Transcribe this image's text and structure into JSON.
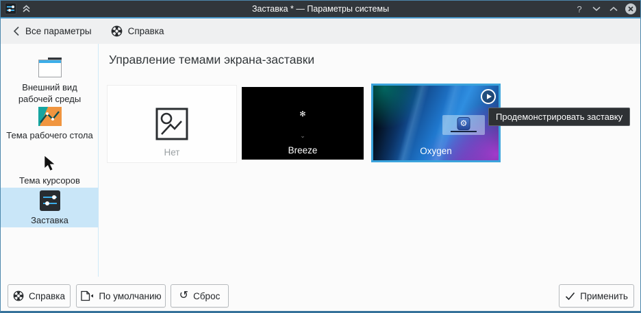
{
  "colors": {
    "accent": "#3daee9",
    "titlebar_bg": "#31363b",
    "selection_bg": "#c9e6f8",
    "window_bg": "#fbfbfb",
    "toolbar_bg": "#eff0f1",
    "selected_card_border": "#3ba3dc"
  },
  "titlebar": {
    "title": "Заставка * — Параметры системы",
    "controls": {
      "help": "?"
    }
  },
  "toolbar": {
    "back_label": "Все параметры",
    "help_label": "Справка"
  },
  "sidebar": {
    "items": [
      {
        "label": "Внешний вид рабочей среды",
        "icon": "desktop-appearance-icon",
        "selected": false
      },
      {
        "label": "Тема рабочего стола",
        "icon": "desktop-theme-icon",
        "selected": false
      },
      {
        "label": "Тема курсоров",
        "icon": "cursor-theme-icon",
        "selected": false
      },
      {
        "label": "Заставка",
        "icon": "screen-locker-icon",
        "selected": true
      }
    ]
  },
  "main": {
    "heading": "Управление темами экрана-заставки",
    "themes": [
      {
        "name": "Нет",
        "selected": false
      },
      {
        "name": "Breeze",
        "selected": false,
        "glyph": "✻",
        "chevron": "⌄"
      },
      {
        "name": "Oxygen",
        "selected": true,
        "logo_glyph": "⚙"
      }
    ]
  },
  "tooltip": {
    "text": "Продемонстрировать заставку"
  },
  "footer": {
    "help": "Справка",
    "defaults": "По умолчанию",
    "reset": "Сброс",
    "reset_glyph": "↺",
    "apply": "Применить"
  }
}
